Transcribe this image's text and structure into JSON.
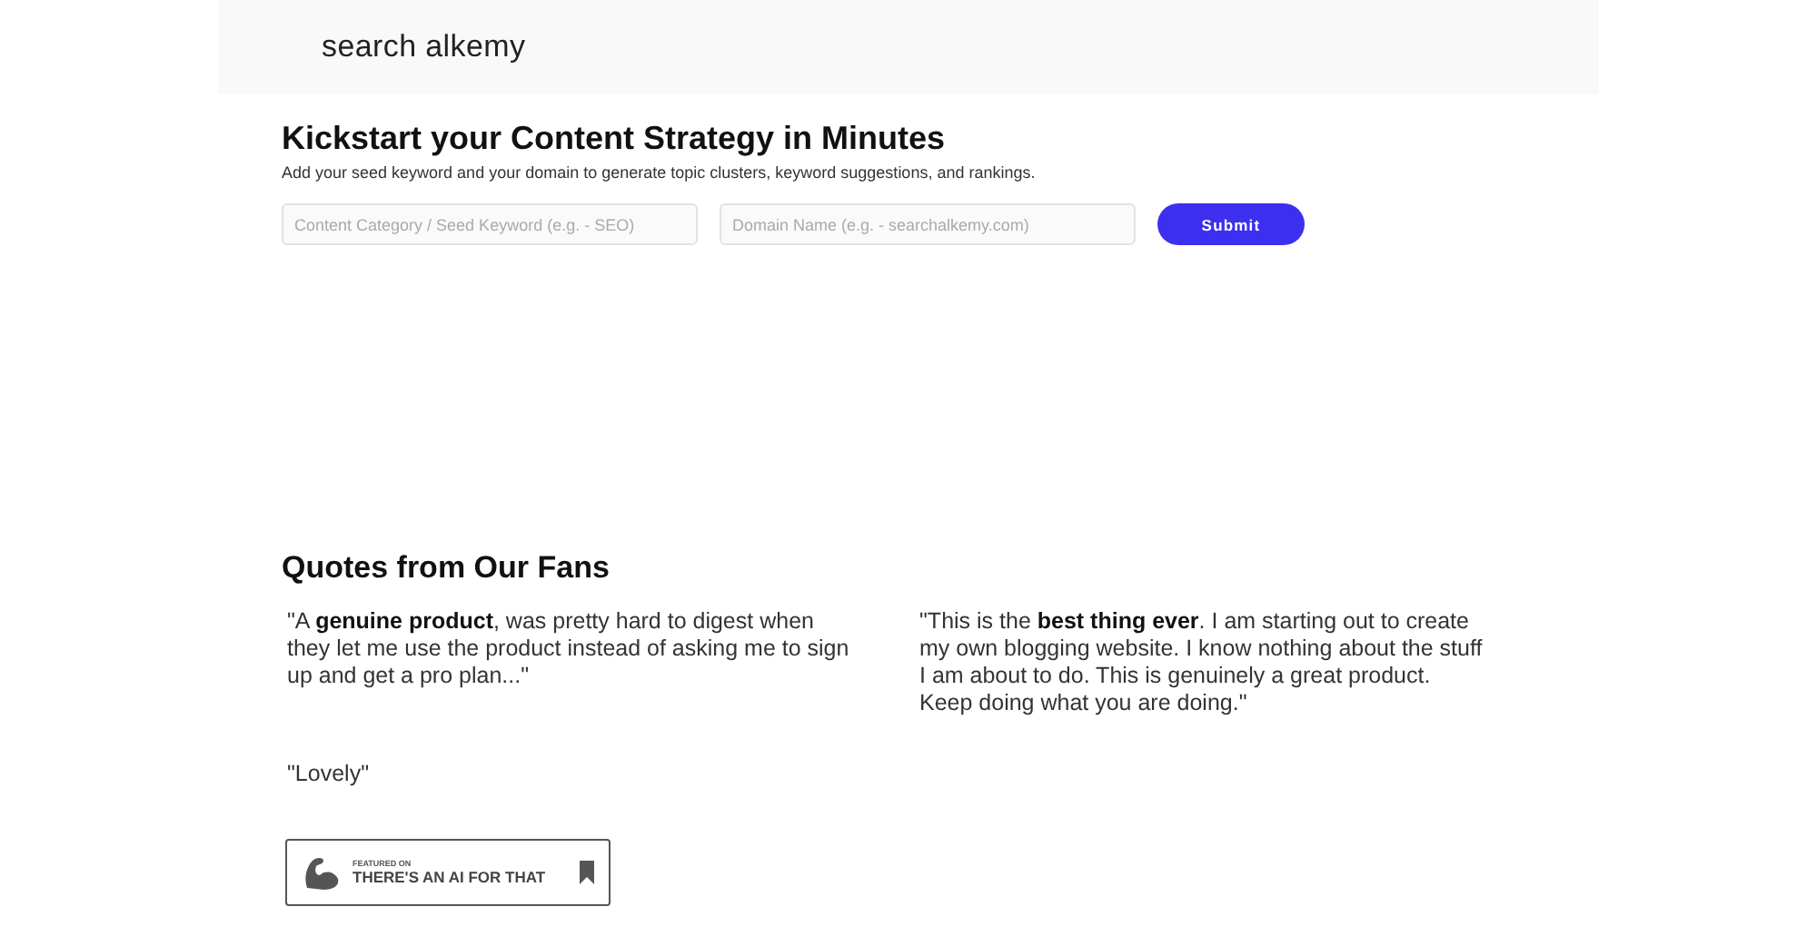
{
  "header": {
    "logo": "search alkemy"
  },
  "hero": {
    "title": "Kickstart your Content Strategy in Minutes",
    "subtitle": "Add your seed keyword and your domain to generate topic clusters, keyword suggestions, and rankings.",
    "fields": [
      {
        "placeholder": "Content Category / Seed Keyword (e.g. - SEO)"
      },
      {
        "placeholder": "Domain Name (e.g. - searchalkemy.com)"
      }
    ],
    "button": "Submit"
  },
  "quotes": {
    "title": "Quotes from Our Fans",
    "items": [
      {
        "text": "\"A **genuine product**, was pretty hard to digest when they let me use the product instead of asking me to sign up and get a pro plan...\""
      },
      {
        "text": "\"This is the **best thing ever**. I am starting out to create my own blogging website. I know nothing about the stuff I am about to do. This is genuinely a great product. Keep doing what you are doing.\""
      },
      {
        "text": "\"Lovely\""
      }
    ]
  },
  "badge": {
    "small": "FEATURED ON",
    "big": "THERE'S AN AI FOR THAT"
  }
}
